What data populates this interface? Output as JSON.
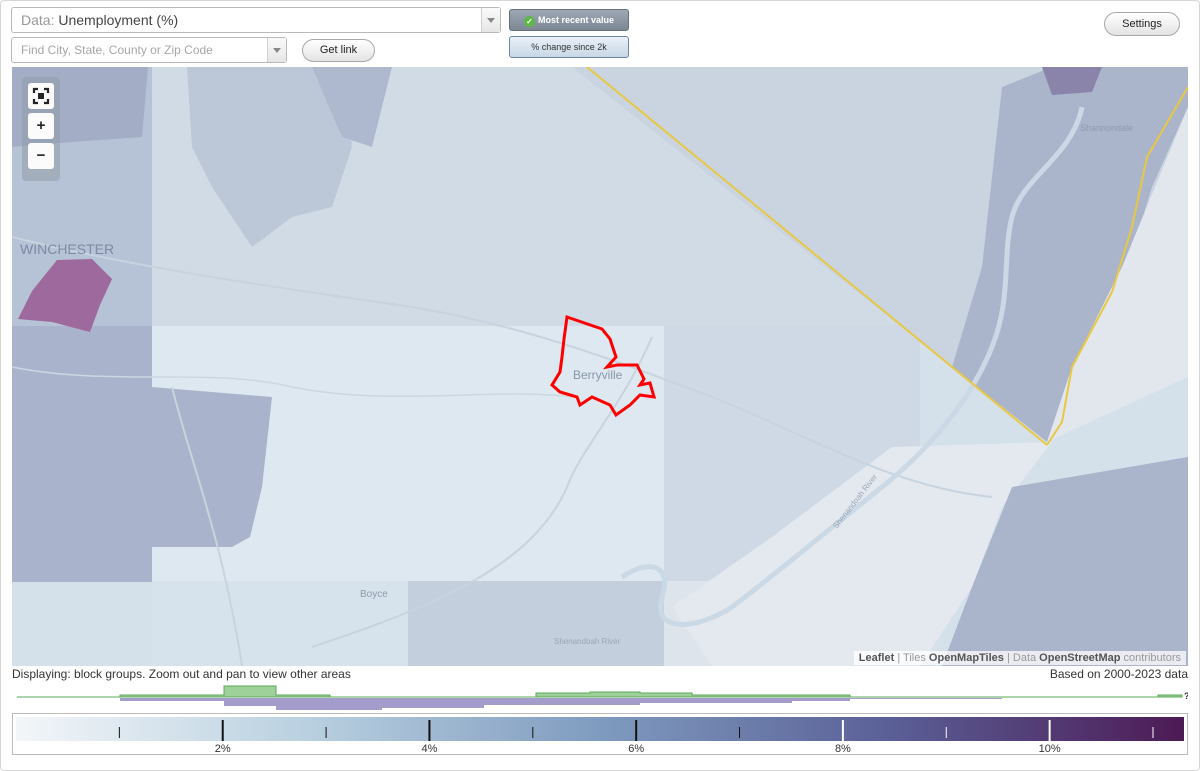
{
  "toolbar": {
    "data_label": "Data:",
    "data_value": "Unemployment (%)",
    "search_placeholder": "Find City, State, County or Zip Code",
    "get_link": "Get link",
    "settings": "Settings",
    "mode_recent": "Most recent value",
    "mode_change": "% change since 2k"
  },
  "map": {
    "places": [
      "WINCHESTER",
      "Berryville",
      "Shannondale",
      "Boyce",
      "Shenandoah River",
      "Shenandoah River"
    ],
    "zoom_in": "+",
    "zoom_out": "−",
    "attribution": {
      "leaflet": "Leaflet",
      "tiles_prefix": " | Tiles ",
      "tiles": "OpenMapTiles",
      "data_prefix": " | Data ",
      "data": "OpenStreetMap",
      "suffix": " contributors"
    }
  },
  "status": {
    "displaying": "Displaying: block groups. Zoom out and pan to view other areas",
    "based_on": "Based on 2000-2023 data"
  },
  "histogram": {
    "unknown_marker": "?"
  },
  "legend": {
    "min": 0,
    "max": 11.3,
    "ticks": [
      "2%",
      "4%",
      "6%",
      "8%",
      "10%"
    ],
    "tick_values": [
      2,
      4,
      6,
      8,
      10
    ],
    "minor_values": [
      1,
      3,
      5,
      7,
      9,
      11
    ],
    "color_stops": [
      "#f3f6f9",
      "#b9d0e0",
      "#7f9bbf",
      "#5a5f96",
      "#4d1a55"
    ]
  },
  "colors": {
    "highlight": "#ff0000",
    "state_border": "#e8c840",
    "hist_green": "#9ed09a",
    "hist_purple": "#a49dcc"
  }
}
